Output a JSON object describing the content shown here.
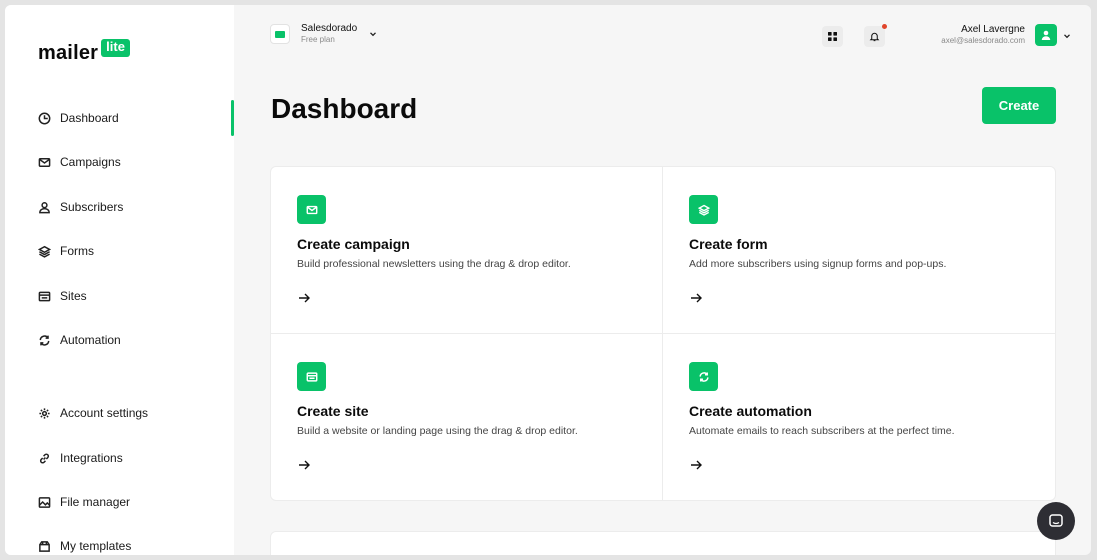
{
  "brand": {
    "word": "mailer",
    "badge": "lite"
  },
  "sidebar": {
    "items": [
      {
        "label": "Dashboard",
        "icon": "dashboard-icon",
        "active": true
      },
      {
        "label": "Campaigns",
        "icon": "mail-icon"
      },
      {
        "label": "Subscribers",
        "icon": "user-icon"
      },
      {
        "label": "Forms",
        "icon": "layers-icon"
      },
      {
        "label": "Sites",
        "icon": "browser-icon"
      },
      {
        "label": "Automation",
        "icon": "refresh-icon"
      },
      {
        "label": "Account settings",
        "icon": "gear-icon"
      },
      {
        "label": "Integrations",
        "icon": "link-icon"
      },
      {
        "label": "File manager",
        "icon": "image-icon"
      },
      {
        "label": "My templates",
        "icon": "template-icon"
      }
    ]
  },
  "workspace": {
    "name": "Salesdorado",
    "plan": "Free plan"
  },
  "user": {
    "name": "Axel Lavergne",
    "email": "axel@salesdorado.com"
  },
  "main": {
    "title": "Dashboard",
    "create_label": "Create",
    "cards": [
      {
        "title": "Create campaign",
        "desc": "Build professional newsletters using the drag & drop editor.",
        "icon": "mail-icon"
      },
      {
        "title": "Create form",
        "desc": "Add more subscribers using signup forms and pop-ups.",
        "icon": "layers-icon"
      },
      {
        "title": "Create site",
        "desc": "Build a website or landing page using the drag & drop editor.",
        "icon": "browser-icon"
      },
      {
        "title": "Create automation",
        "desc": "Automate emails to reach subscribers at the perfect time.",
        "icon": "refresh-icon"
      }
    ]
  },
  "colors": {
    "accent": "#09c269",
    "notification": "#e0452b",
    "chat": "#2e2e34"
  }
}
